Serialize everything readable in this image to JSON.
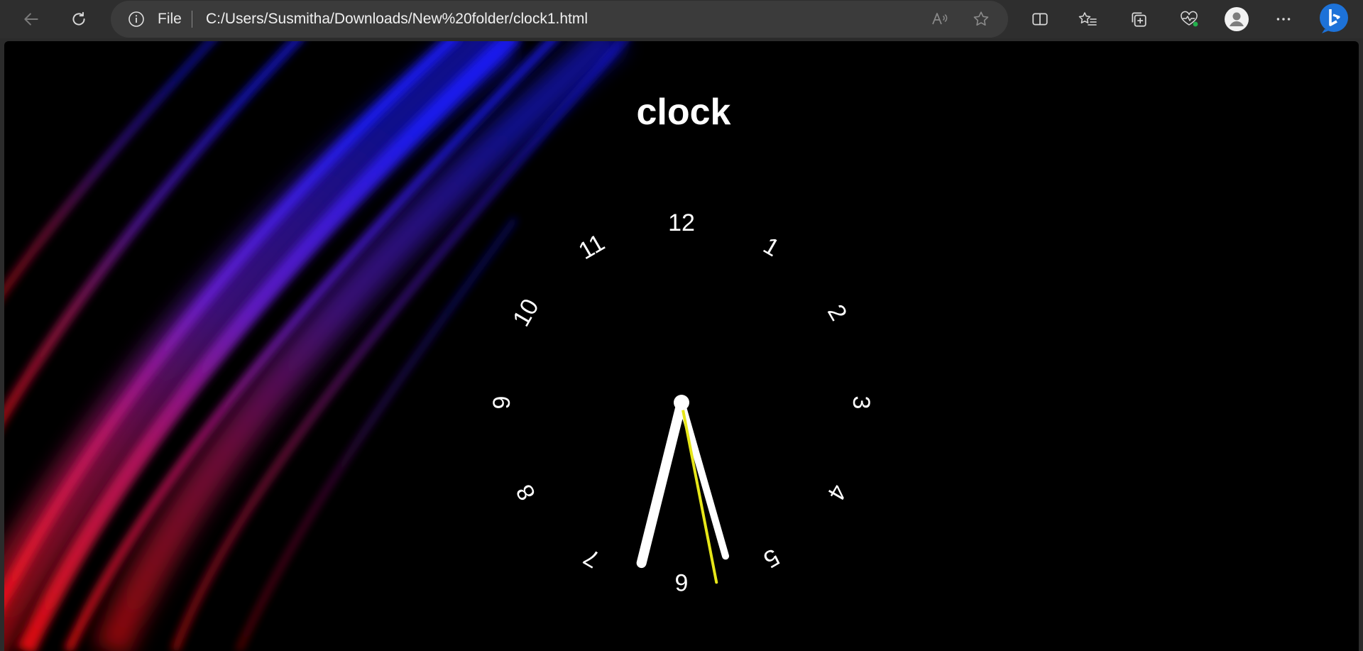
{
  "browser": {
    "address": {
      "scheme_label": "File",
      "url": "C:/Users/Susmitha/Downloads/New%20folder/clock1.html"
    },
    "icons": {
      "back": "back-arrow-icon",
      "refresh": "refresh-icon",
      "info": "info-icon",
      "read_aloud": "read-aloud-icon",
      "favorite": "star-icon",
      "split_screen": "split-screen-icon",
      "favorites": "favorites-icon",
      "collections": "collections-icon",
      "health": "browser-essentials-icon",
      "profile": "profile-avatar-icon",
      "more": "more-options-icon",
      "copilot": "bing-copilot-icon"
    }
  },
  "page": {
    "title": "clock",
    "background": "#000000",
    "streak_colors": [
      "#1a1aff",
      "#6a1bd6",
      "#c2186a",
      "#ff1010"
    ]
  },
  "clock": {
    "numerals": [
      "12",
      "1",
      "2",
      "3",
      "4",
      "5",
      "6",
      "7",
      "8",
      "9",
      "10",
      "11"
    ],
    "hour_hand_deg": 194,
    "minute_hand_deg": 164,
    "second_hand_deg": 169,
    "second_hand_color": "#e6e619",
    "hand_color": "#ffffff"
  }
}
